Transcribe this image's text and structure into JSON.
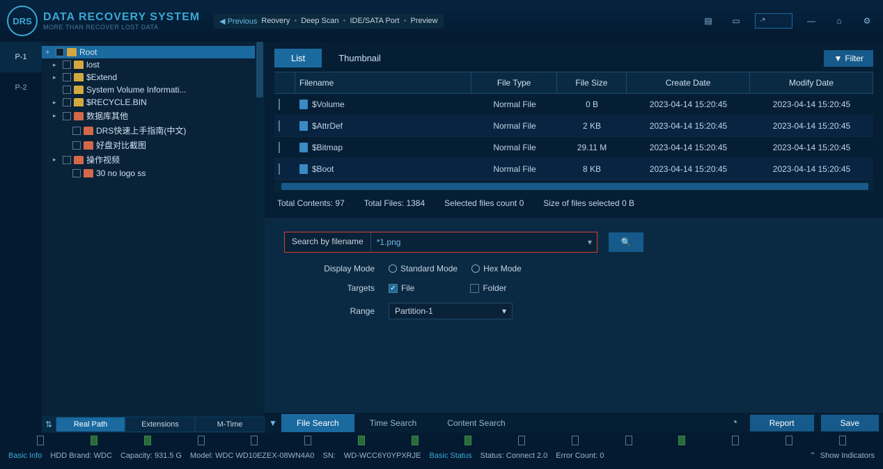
{
  "app": {
    "title": "DATA RECOVERY SYSTEM",
    "subtitle": "MORE THAN RECOVER LOST DATA",
    "logo": "DRS"
  },
  "breadcrumb": {
    "prev": "◀ Previous",
    "path": [
      "Reovery",
      "Deep Scan",
      "IDE/SATA Port",
      "Preview"
    ]
  },
  "header_search": "·*",
  "partitions": [
    "P-1",
    "P-2"
  ],
  "tree": [
    {
      "label": "Root",
      "indent": 0,
      "selected": true,
      "expanded": true,
      "imgfolder": false
    },
    {
      "label": "lost",
      "indent": 1,
      "expanded": false,
      "imgfolder": false
    },
    {
      "label": "$Extend",
      "indent": 1,
      "expanded": false,
      "imgfolder": false
    },
    {
      "label": "System Volume Informati...",
      "indent": 1,
      "noexp": true,
      "imgfolder": false
    },
    {
      "label": "$RECYCLE.BIN",
      "indent": 1,
      "expanded": false,
      "imgfolder": false
    },
    {
      "label": "数据库其他",
      "indent": 1,
      "expanded": false,
      "imgfolder": true
    },
    {
      "label": "DRS快速上手指南(中文)",
      "indent": 2,
      "noexp": true,
      "imgfolder": true
    },
    {
      "label": "好盘对比截图",
      "indent": 2,
      "noexp": true,
      "imgfolder": true
    },
    {
      "label": "操作视频",
      "indent": 1,
      "expanded": false,
      "imgfolder": true
    },
    {
      "label": "30 no logo ss",
      "indent": 2,
      "noexp": true,
      "imgfolder": true
    }
  ],
  "tree_tabs": [
    "Real Path",
    "Extensions",
    "M-Time"
  ],
  "view_tabs": [
    "List",
    "Thumbnail"
  ],
  "filter_label": "Filter",
  "table": {
    "headers": [
      "Filename",
      "File Type",
      "File Size",
      "Create Date",
      "Modify Date"
    ],
    "rows": [
      {
        "name": "$Volume",
        "type": "Normal File",
        "size": "0 B",
        "create": "2023-04-14 15:20:45",
        "modify": "2023-04-14 15:20:45"
      },
      {
        "name": "$AttrDef",
        "type": "Normal File",
        "size": "2 KB",
        "create": "2023-04-14 15:20:45",
        "modify": "2023-04-14 15:20:45"
      },
      {
        "name": "$Bitmap",
        "type": "Normal File",
        "size": "29.11 M",
        "create": "2023-04-14 15:20:45",
        "modify": "2023-04-14 15:20:45"
      },
      {
        "name": "$Boot",
        "type": "Normal File",
        "size": "8 KB",
        "create": "2023-04-14 15:20:45",
        "modify": "2023-04-14 15:20:45"
      }
    ]
  },
  "stats": {
    "total_contents_label": "Total Contents:",
    "total_contents": "97",
    "total_files_label": "Total Files:",
    "total_files": "1384",
    "selected_count_label": "Selected files count",
    "selected_count": "0",
    "selected_size_label": "Size of files  selected",
    "selected_size": "0 B"
  },
  "search": {
    "field_label": "Search by filename",
    "value": "*1.png",
    "display_mode_label": "Display Mode",
    "standard": "Standard Mode",
    "hex": "Hex Mode",
    "targets_label": "Targets",
    "file": "File",
    "folder": "Folder",
    "range_label": "Range",
    "range_value": "Partition-1"
  },
  "bottom_tabs": [
    "File Search",
    "Time Search",
    "Content Search"
  ],
  "buttons": {
    "report": "Report",
    "save": "Save"
  },
  "footer": {
    "basic_info": "Basic Info",
    "hdd_brand": "HDD Brand: WDC",
    "capacity": "Capacity: 931.5 G",
    "model": "Model: WDC WD10EZEX-08WN4A0",
    "sn_label": "SN:",
    "sn": "WD-WCC6Y0YPXRJE",
    "basic_status": "Basic Status",
    "status": "Status: Connect 2.0",
    "error": "Error Count: 0",
    "show_indicators": "Show Indicators"
  }
}
